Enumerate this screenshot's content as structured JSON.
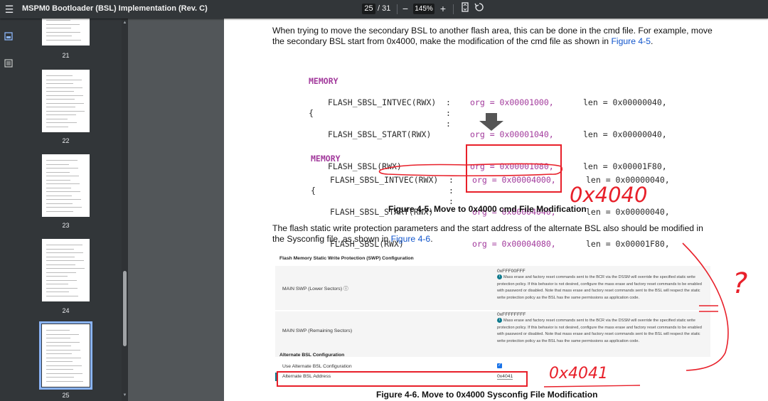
{
  "toolbar": {
    "title": "MSPM0 Bootloader (BSL) Implementation (Rev. C)",
    "current_page": "25",
    "total_pages": "/ 31",
    "zoom": "145%",
    "minus": "−",
    "plus": "+"
  },
  "sidebar": {
    "thumbnails": [
      {
        "number": "21"
      },
      {
        "number": "22"
      },
      {
        "number": "23"
      },
      {
        "number": "24"
      },
      {
        "number": "25"
      }
    ],
    "selected": "25"
  },
  "document": {
    "intro_text": "When trying to move the secondary BSL to another flash area, this can be done in the cmd file. For example, move the secondary BSL start from 0x4000, make the modification of the cmd file as shown in ",
    "intro_link": "Figure 4-5",
    "intro_end": ".",
    "code_before": {
      "keyword": "MEMORY",
      "brace": "{",
      "lines": [
        {
          "name": "FLASH_SBSL_INTVEC(RWX)",
          "org": "org = 0x00001000,",
          "len": "len = 0x00000040,"
        },
        {
          "name": "FLASH_SBSL_START(RWX)",
          "org": "org = 0x00001040,",
          "len": "len = 0x00000040,"
        },
        {
          "name": "FLASH_SBSL(RWX)",
          "org": "org = 0x00001080,",
          "len": "len = 0x00001F80,"
        }
      ]
    },
    "code_after": {
      "keyword": "MEMORY",
      "brace": "{",
      "lines": [
        {
          "name": "FLASH_SBSL_INTVEC(RWX)",
          "org": "org = 0x00004000,",
          "len": "len = 0x00000040,"
        },
        {
          "name": "FLASH_SBSL_START(RWX)",
          "org": "org = 0x00004040,",
          "len": "len = 0x00000040,"
        },
        {
          "name": "FLASH_SBSL(RWX)",
          "org": "org = 0x00004080,",
          "len": "len = 0x00001F80,"
        }
      ]
    },
    "colon": ":",
    "figure_4_5_caption": "Figure 4-5. Move to 0x4000 cmd File Modification",
    "para2_text": "The flash static write protection parameters and the start address of the alternate BSL also should be modified in the Sysconfig file, as shown in ",
    "para2_link": "Figure 4-6",
    "para2_end": ".",
    "figure_4_6_caption": "Figure 4-6. Move to 0x4000 Sysconfig File Modification"
  },
  "sysconfig": {
    "swp_header": "Flash Memory Static Write Protection (SWP) Configuration",
    "main_swp_lower_label": "MAIN SWP (Lower Sectors)",
    "main_swp_lower_value": "0xFFF00FFF",
    "main_swp_remaining_label": "MAIN SWP (Remaining Sectors)",
    "main_swp_remaining_value": "0xFFFFFFFF",
    "warning_note": "Mass erase and factory reset commands sent to the BCR via the DSSM will override the specified static write protection policy. If this behavior is not desired, configure the mass erase and factory reset commands to be enabled with password or disabled. Note that mass erase and factory reset commands sent to the BSL will respect the static write protection policy as the BSL has the same permissions as application code.",
    "alt_bsl_header": "Alternate BSL Configuration",
    "use_alt_bsl_label": "Use Alternate BSL Configuration",
    "alt_bsl_address_label": "Alternate BSL Address",
    "alt_bsl_address_value": "0x4041"
  },
  "annotations": {
    "handwritten_1": "0x4040",
    "handwritten_2": "0x4041",
    "question_mark": "?",
    "color": "#e8202a"
  }
}
